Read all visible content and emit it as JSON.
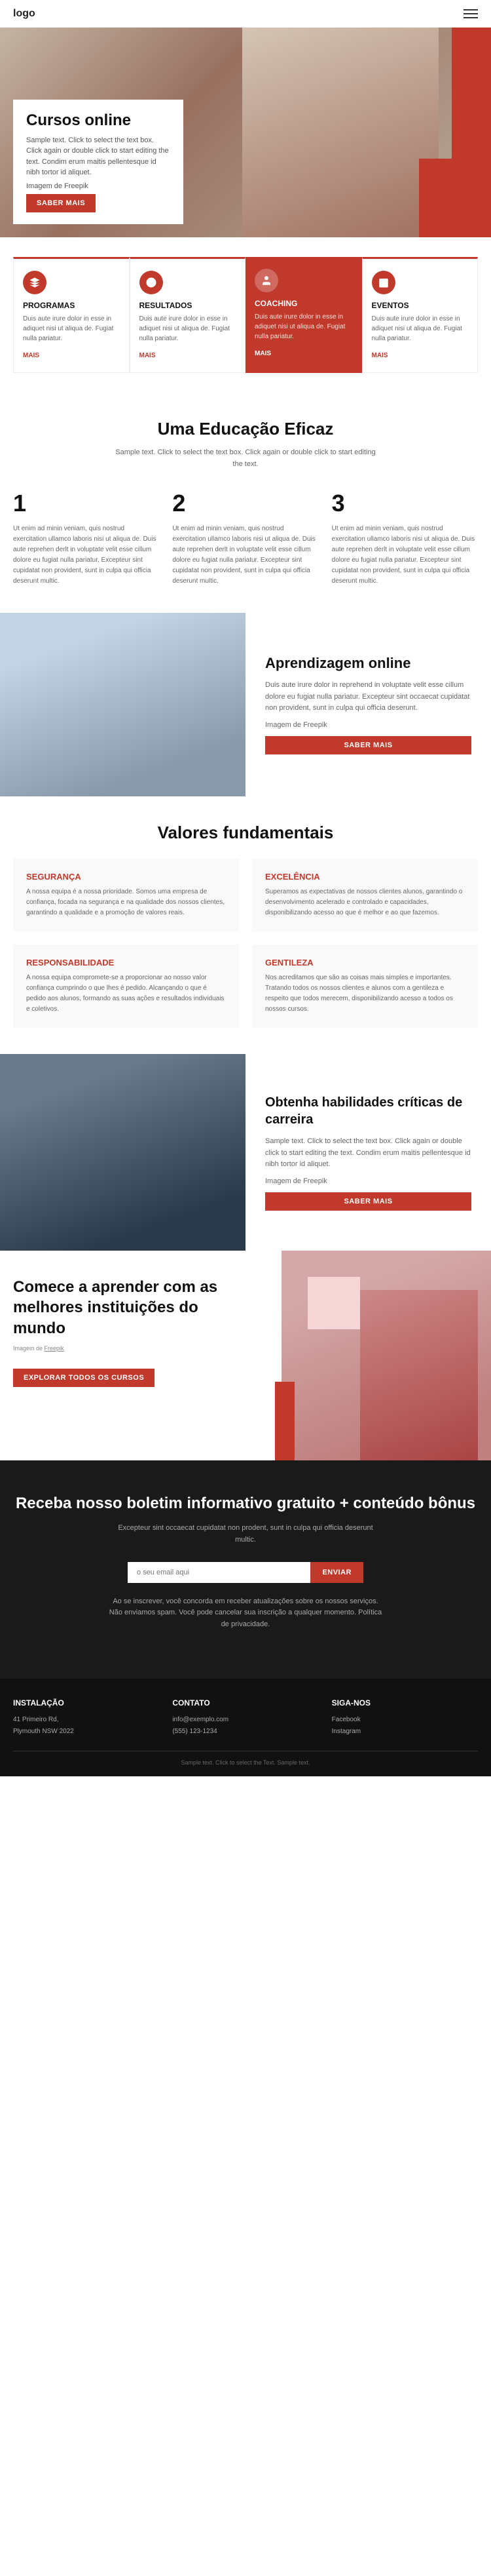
{
  "header": {
    "logo": "logo",
    "menu_icon": "≡"
  },
  "hero": {
    "title": "Cursos online",
    "description": "Sample text. Click to select the text box. Click again or double click to start editing the text. Condim erum maitis pellentesque id nibh tortor id aliquet.",
    "image_credit": "Imagem de Freepik",
    "image_credit_link": "#",
    "cta_label": "SABER MAIS"
  },
  "cards": [
    {
      "id": "programas",
      "title": "PROGRAMAS",
      "description": "Duis aute irure dolor in esse in adiquet nisi ut aliqua de. Fugiat nulla pariatur.",
      "link": "MAIS"
    },
    {
      "id": "resultados",
      "title": "RESULTADOS",
      "description": "Duis aute irure dolor in esse in adiquet nisi ut aliqua de. Fugiat nulla pariatur.",
      "link": "MAIS"
    },
    {
      "id": "coaching",
      "title": "COACHING",
      "description": "Duis aute irure dolor in esse in adiquet nisi ut aliqua de. Fugiat nulla pariatur.",
      "link": "MAIS"
    },
    {
      "id": "eventos",
      "title": "EVENTOS",
      "description": "Duis aute irure dolor in esse in adiquet nisi ut aliqua de. Fugiat nulla pariatur.",
      "link": "MAIS"
    }
  ],
  "effective": {
    "title": "Uma Educação Eficaz",
    "subtitle": "Sample text. Click to select the text box. Click again or double click to start editing the text.",
    "steps": [
      {
        "number": "1",
        "text": "Ut enim ad minin veniam, quis nostrud exercitation ullamco laboris nisi ut aliqua de. Duis aute reprehen derlt in voluptate velit esse cillum dolore eu fugiat nulla pariatur. Excepteur sint cupidatat non provident, sunt in culpa qui officia deserunt multic."
      },
      {
        "number": "2",
        "text": "Ut enim ad minin veniam, quis nostrud exercitation ullamco laboris nisi ut aliqua de. Duis aute reprehen derlt in voluptate velit esse cillum dolore eu fugiat nulla pariatur. Excepteur sint cupidatat non provident, sunt in culpa qui officia deserunt multic."
      },
      {
        "number": "3",
        "text": "Ut enim ad minin veniam, quis nostrud exercitation ullamco laboris nisi ut aliqua de. Duis aute reprehen derlt in voluptate velit esse cillum dolore eu fugiat nulla pariatur. Excepteur sint cupidatat non provident, sunt in culpa qui officia deserunt multic."
      }
    ]
  },
  "online": {
    "title": "Aprendizagem online",
    "description": "Duis aute irure dolor in reprehend in voluptate velit esse cillum dolore eu fugiat nulla pariatur. Excepteur sint occaecat cupidatat non provident, sunt in culpa qui officia deserunt.",
    "image_credit": "Imagem de Freepik",
    "image_credit_link": "#",
    "cta_label": "SABER MAIS"
  },
  "values": {
    "title": "Valores fundamentais",
    "items": [
      {
        "title": "SEGURANÇA",
        "text": "A nossa equipa é a nossa prioridade. Somos uma empresa de confiança, focada na segurança e na qualidade dos nossos clientes, garantindo a qualidade e a promoção de valores reais."
      },
      {
        "title": "EXCELÊNCIA",
        "text": "Superamos as expectativas de nossos clientes alunos, garantindo o desenvolvimento acelerado e controlado e capacidades, disponibilizando acesso ao que é melhor e ao que fazemos."
      },
      {
        "title": "RESPONSABILIDADE",
        "text": "A nossa equipa compromete-se a proporcionar ao nosso valor confiança cumprindo o que lhes é pedido. Alcançando o que é pedido aos alunos, formando as suas ações e resultados individuais e coletivos."
      },
      {
        "title": "GENTILEZA",
        "text": "Nos acreditamos que são as coisas mais simples e importantes. Tratando todos os nossos clientes e alunos com a gentileza e respeito que todos merecem, disponibilizando acesso a todos os nossos cursos."
      }
    ]
  },
  "career": {
    "title": "Obtenha habilidades críticas de carreira",
    "description": "Sample text. Click to select the text box. Click again or double click to start editing the text. Condim erum maitis pellentesque id nibh tortor id aliquet.",
    "image_credit": "Imagem de Freepik",
    "image_credit_link": "#",
    "cta_label": "SABER MAIS"
  },
  "institutions": {
    "title": "Comece a aprender com as melhores instituições do mundo",
    "image_credit": "Imagem de",
    "image_credit_link": "Freepik",
    "cta_label": "EXPLORAR TODOS OS CURSOS"
  },
  "newsletter": {
    "title": "Receba nosso boletim informativo gratuito + conteúdo bônus",
    "description": "Excepteur sint occaecat cupidatat non prodent, sunt in culpa qui officia deserunt multic.",
    "input_placeholder": "o seu email aqui",
    "cta_label": "ENVIAR",
    "note": "Ao se inscrever, você concorda em receber atualizações sobre os nossos serviços. Não enviamos spam. Você pode cancelar sua inscrição a qualquer momento. Política de privacidade."
  },
  "footer": {
    "col1": {
      "title": "Instalação",
      "line1": "41 Primeiro Rd,",
      "line2": "Plymouth NSW 2022"
    },
    "col2": {
      "title": "Contato",
      "line1": "info@exemplo.com",
      "line2": "(555) 123-1234"
    },
    "col3": {
      "title": "Siga-nos",
      "link1": "Facebook",
      "link2": "Instagram"
    },
    "bottom": "Sample text. Click to select the Text. Sample text."
  }
}
